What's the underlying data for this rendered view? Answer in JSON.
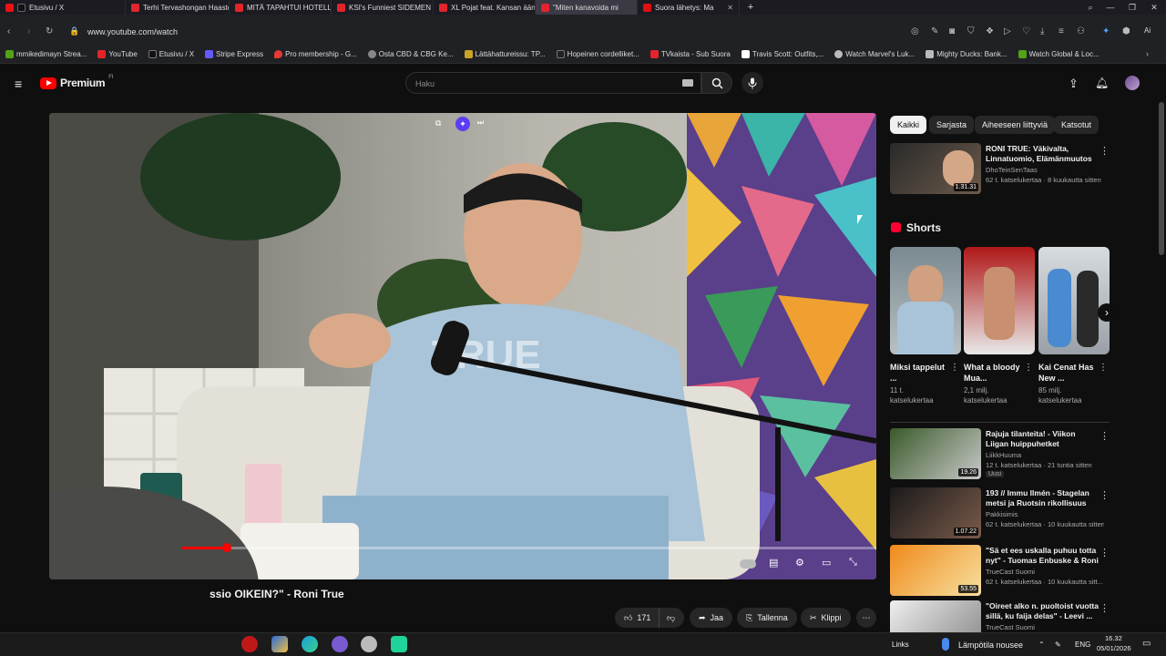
{
  "browser": {
    "tabs": [
      {
        "label": "Etusivu / X",
        "color": "#111111"
      },
      {
        "label": "Terhi Tervashongan Haaste",
        "color": "#e3242b"
      },
      {
        "label": "MITÄ TAPAHTUI HOTELLIIN",
        "color": "#e3242b"
      },
      {
        "label": "KSI's Funniest SIDEMEN M",
        "color": "#e3242b"
      },
      {
        "label": "XL Pojat feat. Kansan äänit",
        "color": "#e3242b"
      },
      {
        "label": "\"Miten kanavoida mi",
        "color": "#e3242b"
      },
      {
        "label": "Suora lähetys: Ma",
        "color": "#d11"
      }
    ],
    "url": "www.youtube.com/watch",
    "bookmarks": [
      {
        "label": "mmikedimayn Strea...",
        "color": "#53a318"
      },
      {
        "label": "YouTube",
        "color": "#e3242b"
      },
      {
        "label": "Etusivu / X",
        "color": "#111111"
      },
      {
        "label": "Stripe Express",
        "color": "#635bff"
      },
      {
        "label": "Pro membership - G...",
        "color": "#e53935"
      },
      {
        "label": "Osta CBD & CBG Ke...",
        "color": "#888888"
      },
      {
        "label": "Lättähattureissu: TP...",
        "color": "#c9a227"
      },
      {
        "label": "Hopeinen cordelliket...",
        "color": "#222222"
      },
      {
        "label": "TVkaista - Sub Suora",
        "color": "#e3242b"
      },
      {
        "label": "Travis Scott: Outfits,...",
        "color": "#ffffff"
      },
      {
        "label": "Watch Marvel's Luk...",
        "color": "#bbbbbb"
      },
      {
        "label": "Mighty Ducks: Bank...",
        "color": "#bbbbbb"
      },
      {
        "label": "Watch Global & Loc...",
        "color": "#53a318"
      }
    ]
  },
  "youtube": {
    "logo": "Premium",
    "logo_sup": "FI",
    "search_placeholder": "Haku"
  },
  "video": {
    "title": "ssio OIKEIN?\" - Roni True",
    "actions": {
      "likes": "171",
      "share": "Jaa",
      "save": "Tallenna",
      "clip": "Klippi"
    }
  },
  "sidebar": {
    "chips": [
      "Kaikki",
      "Sarjasta",
      "Aiheeseen liittyviä",
      "Katsotut"
    ],
    "top_video": {
      "title": "RONI TRUE: Väkivalta, Linnatuomio, Elämänmuutos |...",
      "channel": "DhoTeinSenTaas",
      "meta": "62 t. katselukertaa · 8 kuukautta sitten",
      "duration": "1.31.31"
    },
    "shorts_label": "Shorts",
    "shorts": [
      {
        "title": "Miksi tappelut ...",
        "views_line1": "11 t.",
        "views_line2": "katselukertaa"
      },
      {
        "title": "What a bloody Mua...",
        "views_line1": "2,1 milj.",
        "views_line2": "katselukertaa"
      },
      {
        "title": "Kai Cenat Has New ...",
        "views_line1": "85 milj.",
        "views_line2": "katselukertaa"
      }
    ],
    "videos": [
      {
        "title": "Rajuja tilanteita! - Viikon Liigan huippuhetket",
        "channel": "LiikkHuuma",
        "meta": "12 t. katselukertaa · 21 tuntia sitten",
        "badge": "Uusi",
        "duration": "19.26"
      },
      {
        "title": "193 // Immu Ilmén - Stagelan metsi ja Ruotsin rikollisuus",
        "channel": "Pakkisimis",
        "meta": "62 t. katselukertaa · 10 kuukautta sitten",
        "duration": "1.07.22"
      },
      {
        "title": "\"Sä et ees uskalla puhuu totta nyt\" - Tuomas Enbuske & Roni ...",
        "channel": "TrueCast Suomi",
        "meta": "62 t. katselukertaa · 10 kuukautta sitt...",
        "duration": "53.55"
      },
      {
        "title": "\"Oireet alko n. puoltoist vuotta sillä, ku faija delas\" - Leevi ...",
        "channel": "TrueCast Suomi",
        "meta": "",
        "duration": ""
      }
    ]
  },
  "taskbar": {
    "links": "Links",
    "weather": "Lämpötila nousee",
    "lang": "ENG",
    "time": "16.32",
    "date": "05/01/2026"
  }
}
